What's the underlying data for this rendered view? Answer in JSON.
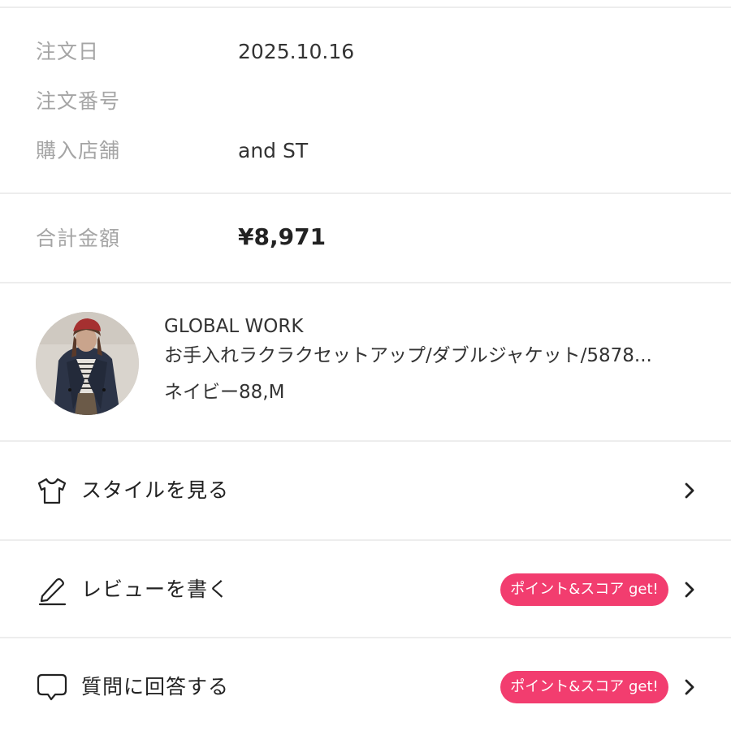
{
  "order": {
    "date_label": "注文日",
    "date_value": "2025.10.16",
    "number_label": "注文番号",
    "number_value": "",
    "store_label": "購入店舗",
    "store_value": "and ST"
  },
  "total": {
    "label": "合計金額",
    "value": "¥8,971"
  },
  "product": {
    "brand": "GLOBAL WORK",
    "name": "お手入れラクラクセットアップ/ダブルジャケット/5878...",
    "variant": "ネイビー88,M"
  },
  "actions": [
    {
      "label": "スタイルを見る",
      "icon": "t-shirt-icon",
      "badge": ""
    },
    {
      "label": "レビューを書く",
      "icon": "pencil-icon",
      "badge": "ポイント&スコア get!"
    },
    {
      "label": "質問に回答する",
      "icon": "speech-bubble-icon",
      "badge": "ポイント&スコア get!"
    }
  ],
  "colors": {
    "badge": "#f23d6f",
    "label_gray": "#a5a5a5",
    "divider": "#ededed"
  }
}
